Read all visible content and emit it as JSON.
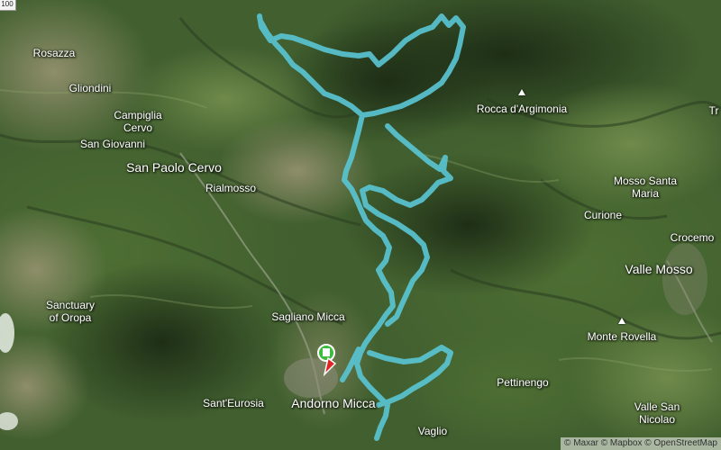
{
  "map": {
    "corner_badge": "100",
    "route_color": "#59c3d1",
    "start_marker_colors": {
      "green": "#3dbb3d",
      "white": "#ffffff",
      "red": "#e02424"
    },
    "finish_marker_color": "#e02424",
    "places": [
      {
        "id": "rosazza",
        "label": "Rosazza"
      },
      {
        "id": "gliondini",
        "label": "Gliondini"
      },
      {
        "id": "campiglia",
        "label": "Campiglia\nCervo"
      },
      {
        "id": "san-giovanni",
        "label": "San Giovanni"
      },
      {
        "id": "san-paolo-cervo",
        "label": "San Paolo Cervo"
      },
      {
        "id": "rialmosso",
        "label": "Rialmosso"
      },
      {
        "id": "rocca-argimonia",
        "label": "Rocca d'Argimonia"
      },
      {
        "id": "mosso-santa-maria",
        "label": "Mosso Santa\nMaria"
      },
      {
        "id": "curione",
        "label": "Curione"
      },
      {
        "id": "crocemosso",
        "label": "Crocemo"
      },
      {
        "id": "valle-mosso",
        "label": "Valle Mosso"
      },
      {
        "id": "sanctuary-oropa",
        "label": "Sanctuary\nof Oropa"
      },
      {
        "id": "sagliano-micca",
        "label": "Sagliano Micca"
      },
      {
        "id": "monte-rovella",
        "label": "Monte Rovella"
      },
      {
        "id": "pettinengo",
        "label": "Pettinengo"
      },
      {
        "id": "sant-eurosia",
        "label": "Sant'Eurosia"
      },
      {
        "id": "andorno-micca",
        "label": "Andorno Micca"
      },
      {
        "id": "vaglio",
        "label": "Vaglio"
      },
      {
        "id": "valle-san-nicolao",
        "label": "Valle San\nNicolao"
      },
      {
        "id": "tr-edge",
        "label": "Tr"
      }
    ],
    "attribution": "© Maxar © Mapbox © OpenStreetMap"
  }
}
